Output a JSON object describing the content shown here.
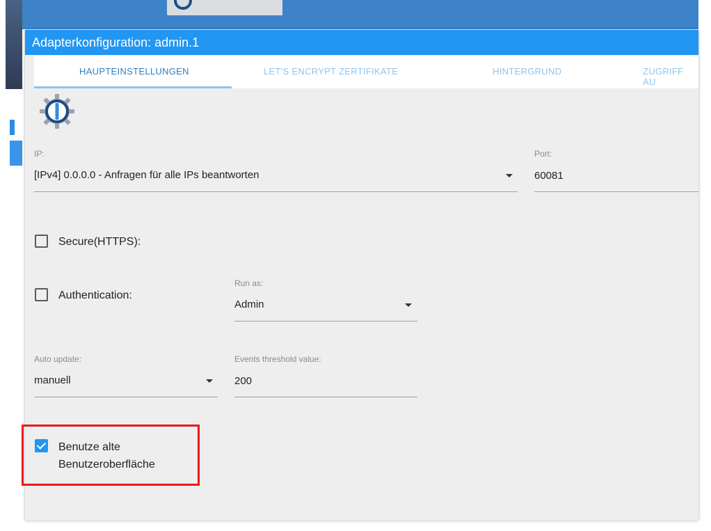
{
  "dialog": {
    "title": "Adapterkonfiguration: admin.1"
  },
  "tabs": [
    {
      "label": "HAUPTEINSTELLUNGEN",
      "active": true
    },
    {
      "label": "LET'S ENCRYPT ZERTIFIKATE",
      "active": false
    },
    {
      "label": "HINTERGRUND",
      "active": false
    },
    {
      "label": "ZUGRIFF AU",
      "active": false
    }
  ],
  "form": {
    "ip": {
      "label": "IP:",
      "value": "[IPv4] 0.0.0.0 - Anfragen für alle IPs beantworten"
    },
    "port": {
      "label": "Port:",
      "value": "60081"
    },
    "secure": {
      "label": "Secure(HTTPS):",
      "checked": false
    },
    "authentication": {
      "label": "Authentication:",
      "checked": false
    },
    "run_as": {
      "label": "Run as:",
      "value": "Admin"
    },
    "auto_update": {
      "label": "Auto update:",
      "value": "manuell"
    },
    "events_threshold": {
      "label": "Events threshold value:",
      "value": "200"
    },
    "old_ui": {
      "label_line1": "Benutze alte",
      "label_line2": "Benutzeroberfläche",
      "checked": true
    }
  },
  "colors": {
    "accent": "#2196f3",
    "highlight": "#e51b1b",
    "tab_active": "#2c7fbf",
    "tab_inactive": "#8fc3ec"
  }
}
